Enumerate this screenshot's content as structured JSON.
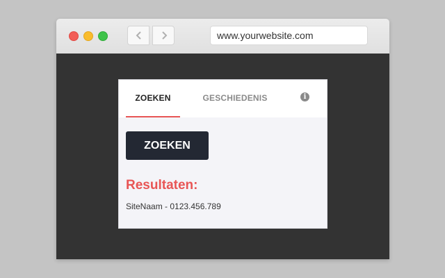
{
  "browser": {
    "url": "www.yourwebsite.com",
    "back_icon": "chevron-left-icon",
    "forward_icon": "chevron-right-icon"
  },
  "widget": {
    "tabs": [
      {
        "label": "ZOEKEN",
        "active": true
      },
      {
        "label": "GESCHIEDENIS",
        "active": false
      }
    ],
    "info_icon": "info-icon",
    "search_button": "ZOEKEN",
    "results_title": "Resultaten:",
    "results": [
      "SiteNaam - 0123.456.789"
    ]
  },
  "colors": {
    "accent": "#e85555",
    "button_bg": "#232833",
    "page_bg": "#333333"
  }
}
